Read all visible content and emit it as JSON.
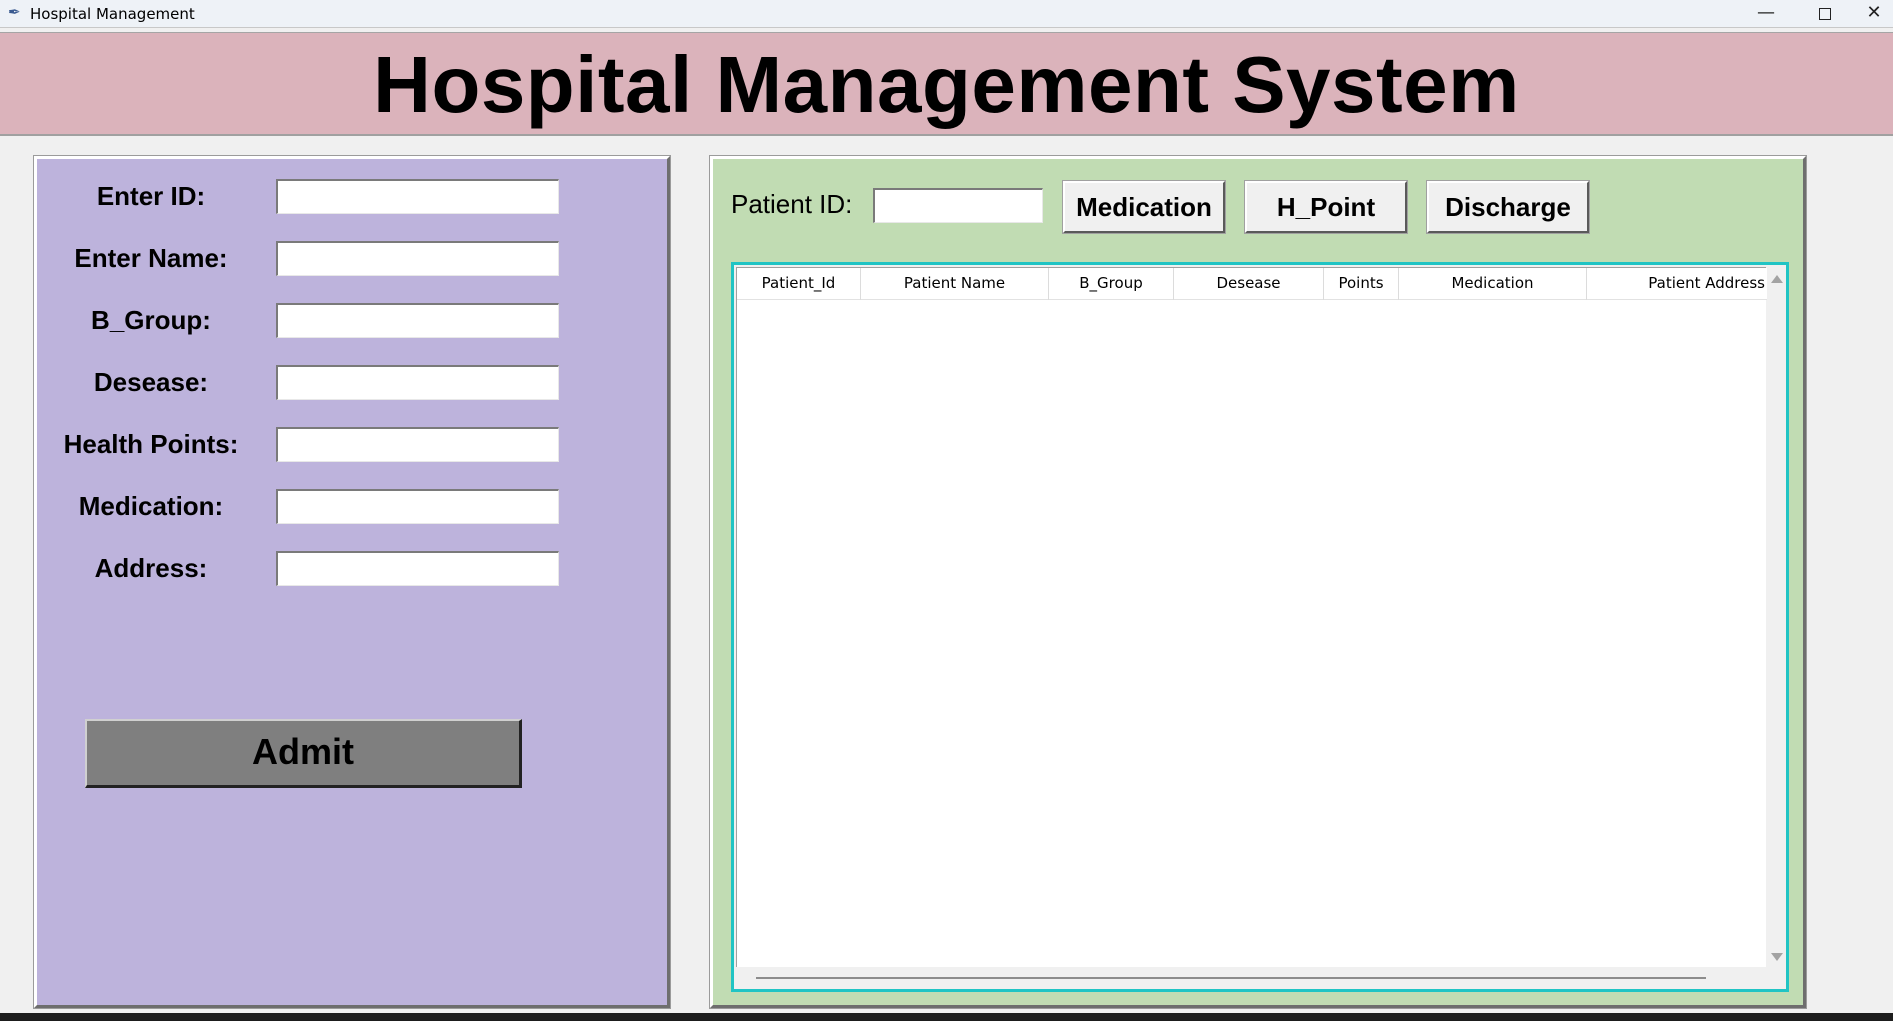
{
  "window": {
    "title": "Hospital Management",
    "icon": "feather-icon",
    "controls": {
      "minimize": "—",
      "close": "✕"
    }
  },
  "header": {
    "title": "Hospital Management System"
  },
  "form": {
    "fields": [
      {
        "label": "Enter ID:",
        "value": ""
      },
      {
        "label": "Enter Name:",
        "value": ""
      },
      {
        "label": "B_Group:",
        "value": ""
      },
      {
        "label": "Desease:",
        "value": ""
      },
      {
        "label": "Health Points:",
        "value": ""
      },
      {
        "label": "Medication:",
        "value": ""
      },
      {
        "label": "Address:",
        "value": ""
      }
    ],
    "submit_label": "Admit"
  },
  "actions": {
    "patient_id_label": "Patient ID:",
    "patient_id_value": "",
    "buttons": [
      "Medication",
      "H_Point",
      "Discharge"
    ]
  },
  "table": {
    "columns": [
      "Patient_Id",
      "Patient Name",
      "B_Group",
      "Desease",
      "Points",
      "Medication",
      "Patient Address"
    ],
    "rows": []
  },
  "colors": {
    "banner": "#dbb3bb",
    "form_panel": "#bdb3dc",
    "table_panel": "#c1dcb3",
    "table_border": "#20c4c4",
    "admit_button": "#7f7f7f"
  }
}
